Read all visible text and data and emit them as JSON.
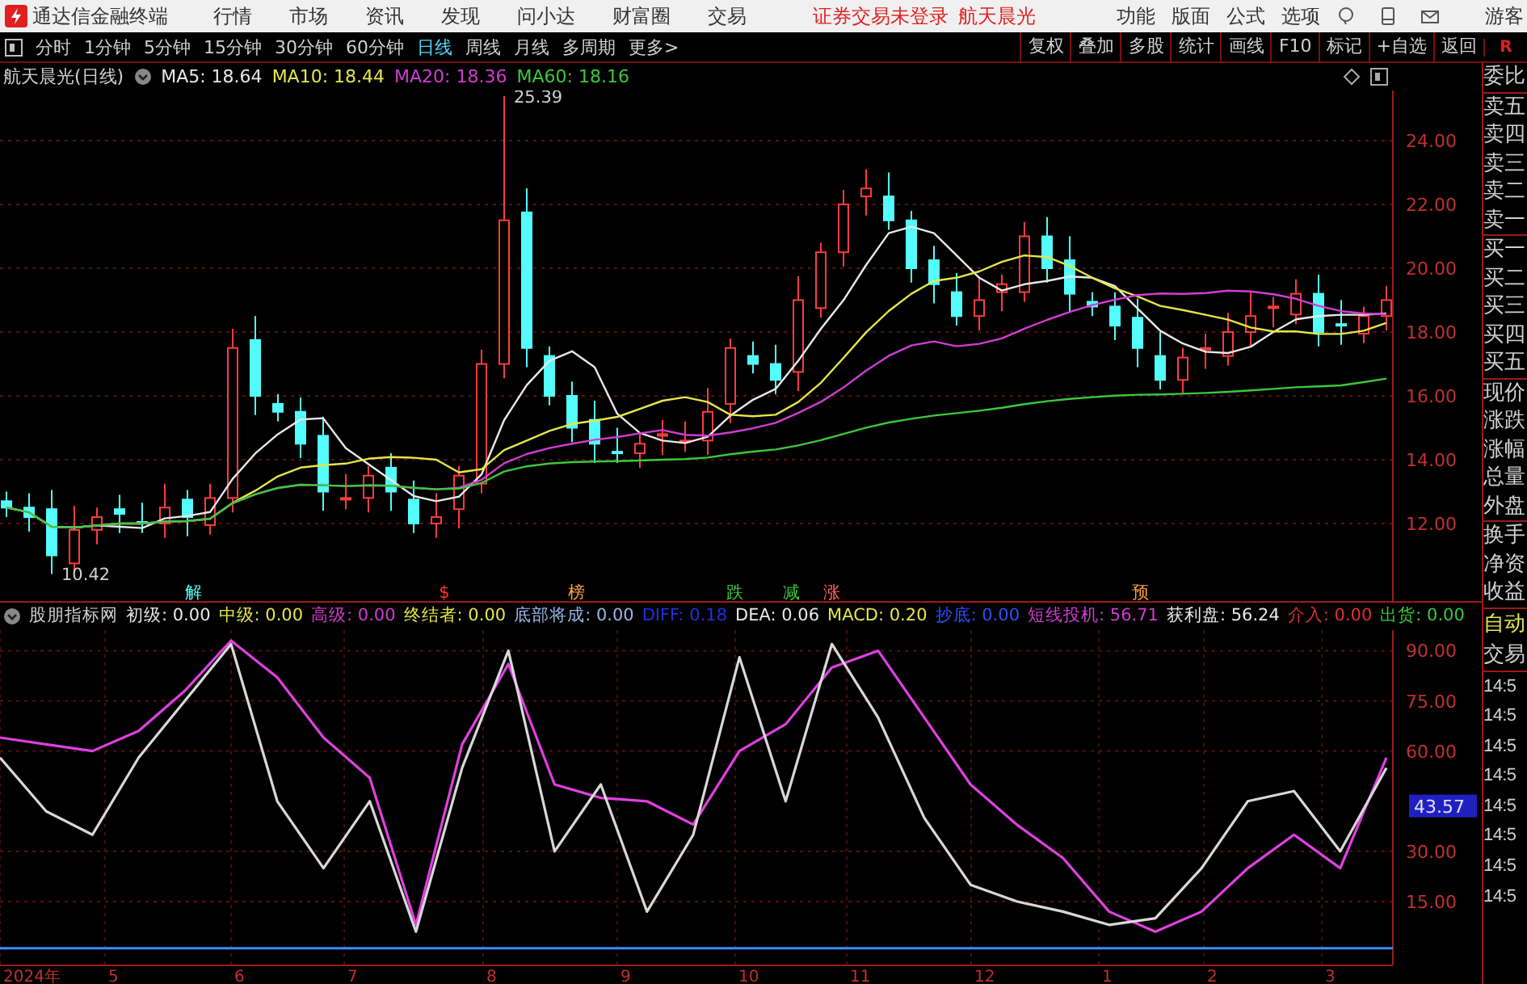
{
  "app": {
    "title": "通达信金融终端",
    "menus": [
      "行情",
      "市场",
      "资讯",
      "发现",
      "问小达",
      "财富圈",
      "交易"
    ],
    "login_status": "证券交易未登录",
    "stock_name": "航天晨光",
    "functions": [
      "功能",
      "版面",
      "公式",
      "选项"
    ],
    "user": "游客"
  },
  "periods": [
    {
      "label": "分时",
      "selected": false
    },
    {
      "label": "1分钟",
      "selected": false
    },
    {
      "label": "5分钟",
      "selected": false
    },
    {
      "label": "15分钟",
      "selected": false
    },
    {
      "label": "30分钟",
      "selected": false
    },
    {
      "label": "60分钟",
      "selected": false
    },
    {
      "label": "日线",
      "selected": true
    },
    {
      "label": "周线",
      "selected": false
    },
    {
      "label": "月线",
      "selected": false
    },
    {
      "label": "多周期",
      "selected": false
    },
    {
      "label": "更多>",
      "selected": false
    }
  ],
  "tools": [
    "复权",
    "叠加",
    "多股",
    "统计",
    "画线",
    "F10",
    "标记",
    "+自选",
    "返回"
  ],
  "tools_flag": "R",
  "main_chart": {
    "title": "航天晨光(日线)",
    "legend": [
      {
        "label": "MA5: 18.64",
        "color": "#e8e8e8"
      },
      {
        "label": "MA10: 18.44",
        "color": "#e6e64a"
      },
      {
        "label": "MA20: 18.36",
        "color": "#d23cd2"
      },
      {
        "label": "MA60: 18.16",
        "color": "#3cc83c"
      }
    ],
    "price_axis": [
      "24.00",
      "22.00",
      "20.00",
      "18.00",
      "16.00",
      "14.00",
      "12.00"
    ],
    "high_label": "25.39",
    "low_label": "10.42",
    "signals": [
      {
        "label": "解",
        "color": "#54fcfc"
      },
      {
        "label": "$",
        "color": "#ff3232"
      },
      {
        "label": "榜",
        "color": "#ffa040"
      },
      {
        "label": "跌",
        "color": "#3cc83c"
      },
      {
        "label": "减",
        "color": "#3cc83c"
      },
      {
        "label": "涨",
        "color": "#ff6060"
      },
      {
        "label": "预",
        "color": "#ffa040"
      }
    ]
  },
  "indicator": {
    "name": "股朋指标网",
    "legend": [
      {
        "label": "初级: 0.00",
        "color": "#e8e8e8"
      },
      {
        "label": "中级: 0.00",
        "color": "#e6e64a"
      },
      {
        "label": "高级: 0.00",
        "color": "#d23cd2"
      },
      {
        "label": "终结者: 0.00",
        "color": "#e6e64a"
      },
      {
        "label": "底部将成: 0.00",
        "color": "#9ab8e8"
      },
      {
        "label": "DIFF: 0.18",
        "color": "#2030e0"
      },
      {
        "label": "DEA: 0.06",
        "color": "#e8e8e8"
      },
      {
        "label": "MACD: 0.20",
        "color": "#e6e64a"
      },
      {
        "label": "抄底: 0.00",
        "color": "#2a50ff"
      },
      {
        "label": "短线投机: 56.71",
        "color": "#d23cd2"
      },
      {
        "label": "获利盘: 56.24",
        "color": "#e8e8e8"
      },
      {
        "label": "介入: 0.00",
        "color": "#e03030"
      },
      {
        "label": "出货: 0.00",
        "color": "#3cc83c"
      }
    ],
    "value_axis": [
      "90.00",
      "75.00",
      "60.00",
      "30.00",
      "15.00"
    ],
    "value_tag": "43.57",
    "date_axis": [
      "2024年",
      "5",
      "6",
      "7",
      "8",
      "9",
      "10",
      "11",
      "12",
      "1",
      "2",
      "3"
    ]
  },
  "quote_panel": [
    [
      "委比"
    ],
    [
      "卖五",
      "卖四",
      "卖三",
      "卖二",
      "卖一"
    ],
    [
      "买一",
      "买二",
      "买三",
      "买四",
      "买五"
    ],
    [
      "现价",
      "涨跌",
      "涨幅",
      "总量",
      "外盘"
    ],
    [
      "换手",
      "净资",
      "收益"
    ]
  ],
  "trade_panel": {
    "mode": "自动",
    "title": "交易",
    "times": [
      "14:5",
      "14:5",
      "14:5",
      "14:5",
      "14:5",
      "14:5",
      "14:5",
      "14:5"
    ]
  }
}
